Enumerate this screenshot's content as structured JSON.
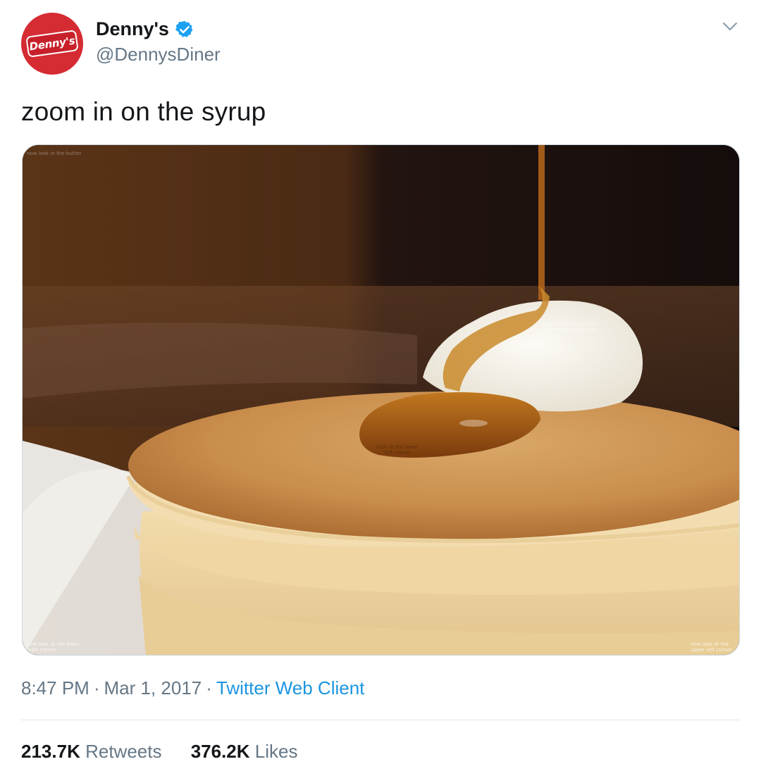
{
  "author": {
    "display_name": "Denny's",
    "handle": "@DennysDiner",
    "avatar_logo_text": "Denny's",
    "verified": true,
    "avatar_color": "#d52b32"
  },
  "tweet": {
    "text": "zoom in on the syrup"
  },
  "media": {
    "description": "",
    "captions": {
      "top_left": "now look in the butter",
      "bottom_left": "now look at the lower right corner",
      "bottom_right": "now look at the upper left corner",
      "butter": "has this distracted you from everything else",
      "syrup": "look at the lower left corner"
    }
  },
  "meta": {
    "time": "8:47 PM",
    "separator": "·",
    "date": "Mar 1, 2017",
    "client": "Twitter Web Client"
  },
  "stats": {
    "retweets_count": "213.7K",
    "retweets_label": "Retweets",
    "likes_count": "376.2K",
    "likes_label": "Likes"
  },
  "colors": {
    "link": "#1b95e0",
    "secondary_text": "#657786",
    "verified_badge": "#1da1f2"
  },
  "icons": [
    "verified-badge-icon",
    "chevron-down-icon"
  ]
}
